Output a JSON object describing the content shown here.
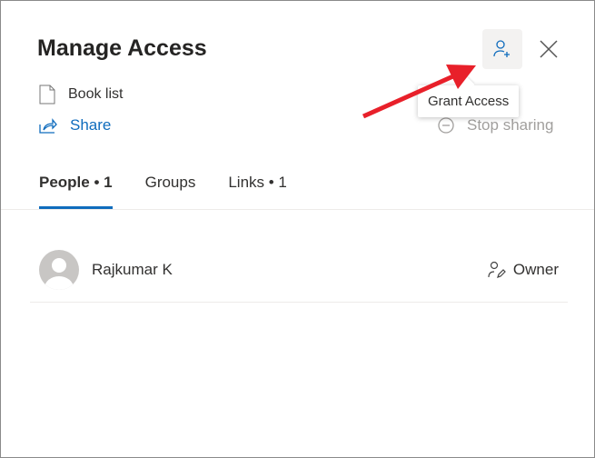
{
  "header": {
    "title": "Manage Access",
    "grant_tooltip": "Grant Access"
  },
  "file": {
    "name": "Book list"
  },
  "actions": {
    "share": "Share",
    "stop_sharing": "Stop sharing"
  },
  "tabs": [
    {
      "label": "People • 1",
      "active": true
    },
    {
      "label": "Groups"
    },
    {
      "label": "Links • 1"
    }
  ],
  "people": [
    {
      "name": "Rajkumar K",
      "role": "Owner"
    }
  ],
  "colors": {
    "accent": "#0f6cbd",
    "annotation_arrow": "#e8202a"
  }
}
